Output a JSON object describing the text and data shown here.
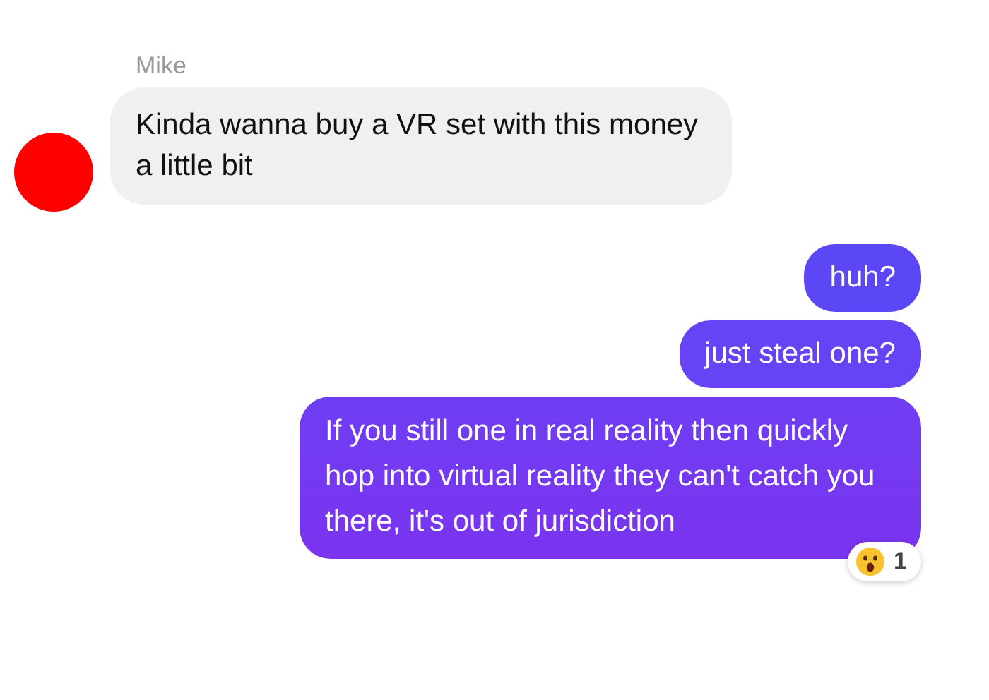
{
  "messages": [
    {
      "kind": "incoming",
      "sender": "Mike",
      "text": "Kinda wanna buy a VR set with this money a little bit"
    },
    {
      "kind": "outgoing",
      "text": "huh?"
    },
    {
      "kind": "outgoing",
      "text": "just steal one?"
    },
    {
      "kind": "outgoing",
      "text": "If you still one in real reality then quickly hop into virtual reality they can't catch you there, it's out of jurisdiction",
      "reaction": {
        "count": "1"
      }
    }
  ]
}
